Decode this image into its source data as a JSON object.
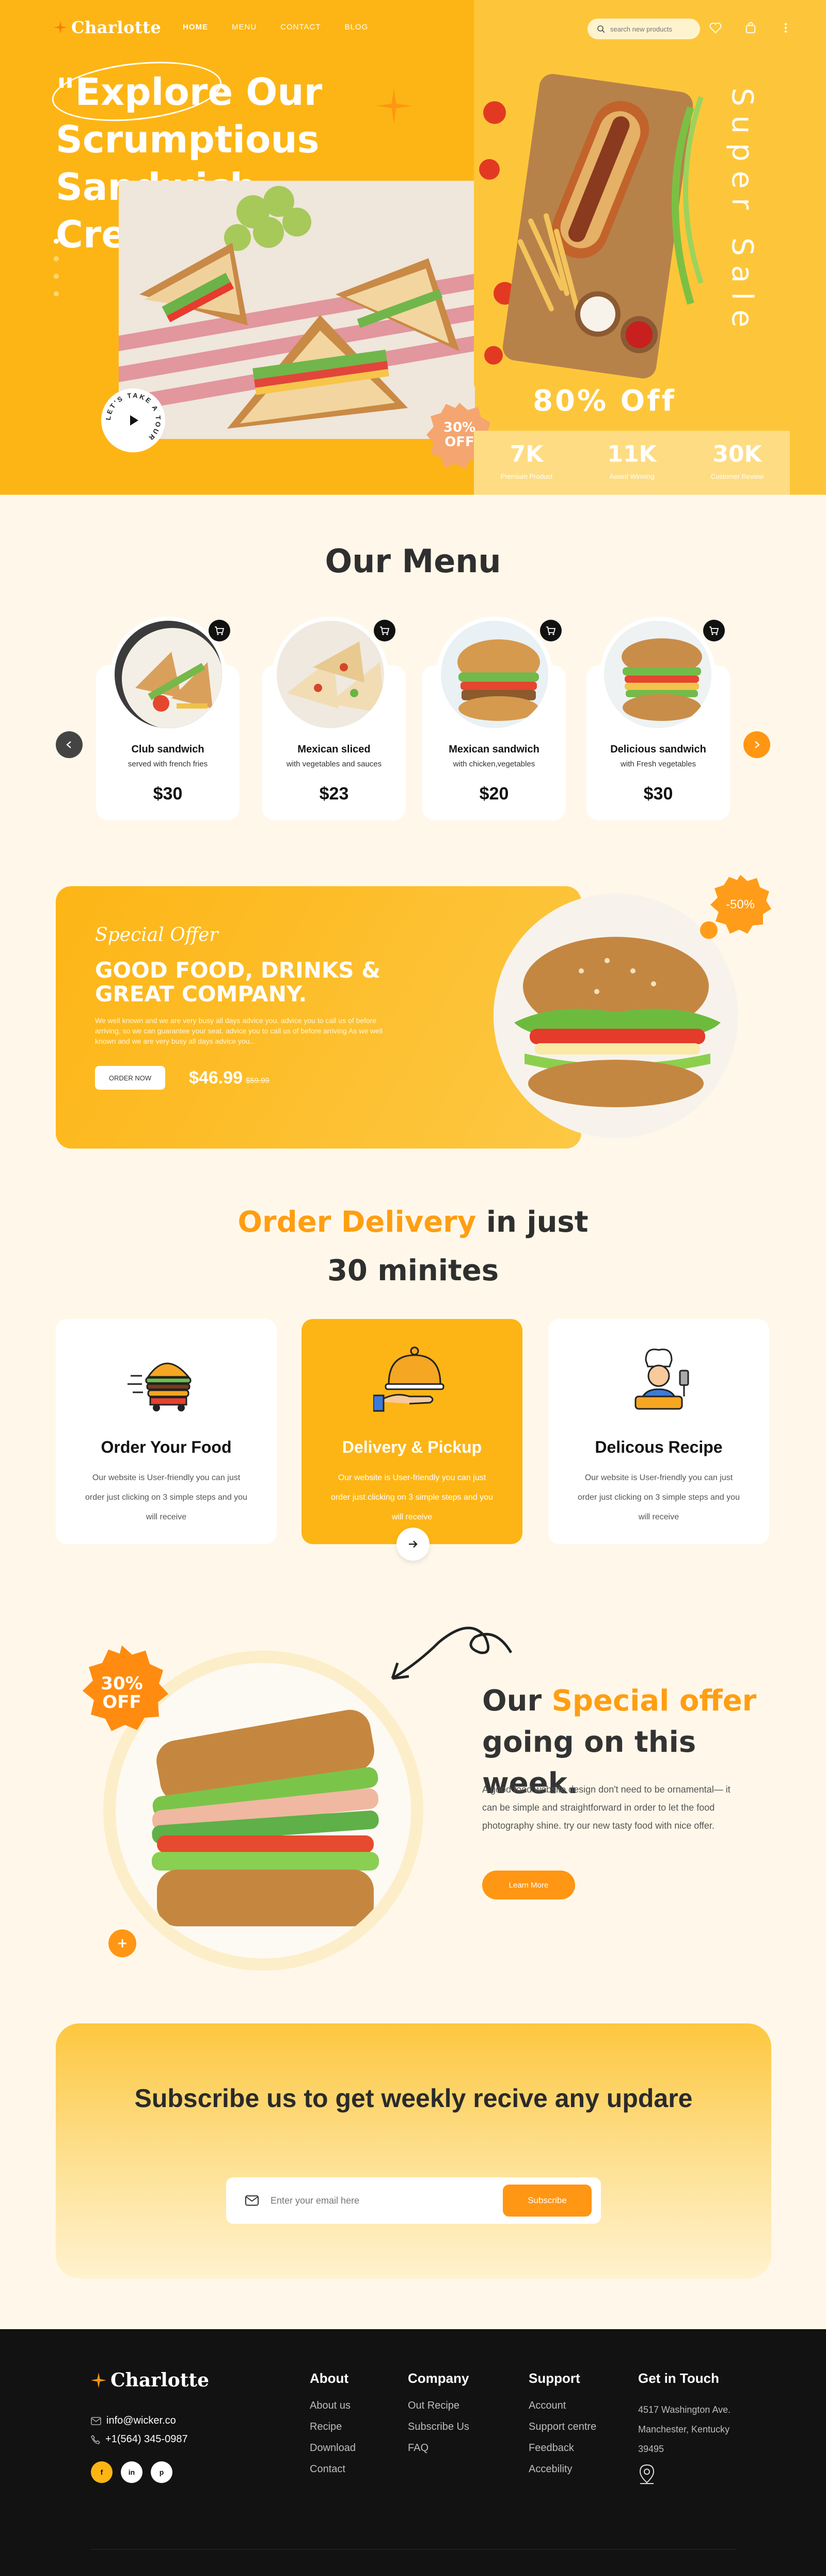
{
  "brand": {
    "name": "Charlotte",
    "accent": "#fdb515",
    "orange": "#ff9614"
  },
  "nav": {
    "items": [
      {
        "label": "HOME",
        "active": true
      },
      {
        "label": "MENU",
        "active": false
      },
      {
        "label": "CONTACT",
        "active": false
      },
      {
        "label": "BLOG",
        "active": false
      }
    ]
  },
  "search": {
    "placeholder": "search new products"
  },
  "icons": [
    "search-icon",
    "heart-icon",
    "bag-icon",
    "menu-dots-icon"
  ],
  "hero": {
    "title": "\"Explore Our Scrumptious Sandwich Creations\"",
    "tour": "LET'S TAKE A TOUR",
    "badge": "30% OFF",
    "super_sale": "Super Sale",
    "promo": "80% Off",
    "stats": [
      {
        "num": "7K",
        "label": "Premium Product"
      },
      {
        "num": "11K",
        "label": "Award Winning"
      },
      {
        "num": "30K",
        "label": "Customer Review"
      }
    ]
  },
  "menu": {
    "title": "Our Menu",
    "items": [
      {
        "name": "Club sandwich",
        "desc": "served with french fries",
        "price": "$30"
      },
      {
        "name": "Mexican sliced",
        "desc": "with vegetables and sauces",
        "price": "$23"
      },
      {
        "name": "Mexican sandwich",
        "desc": "with chicken,vegetables",
        "price": "$20"
      },
      {
        "name": "Delicious sandwich",
        "desc": "with Fresh vegetables",
        "price": "$30"
      }
    ]
  },
  "special": {
    "script": "Special Offer",
    "headline": "GOOD FOOD, DRINKS & GREAT COMPANY.",
    "text": "We well known and we are very busy all days advice you. advice you to call us of before arriving, so we can guarantee your seat. advice you to call us of before arriving As we well known and we are very busy all days advice you...",
    "button": "ORDER NOW",
    "price": "$46.99",
    "old_price": "$59.99",
    "badge": "-50%"
  },
  "delivery": {
    "title_orange": "Order Delivery",
    "title_rest": "in just",
    "title_line2": "30 minites",
    "cards": [
      {
        "title": "Order Your Food",
        "text": "Our website is User-friendly you can just order just clicking on 3 simple steps and you will receive"
      },
      {
        "title": "Delivery & Pickup",
        "text": "Our website is User-friendly you can just order just clicking on 3 simple steps and you will receive"
      },
      {
        "title": "Delicous Recipe",
        "text": "Our website is User-friendly you can just order just clicking on 3 simple steps and you will receive"
      }
    ]
  },
  "weekly": {
    "badge": "30% OFF",
    "head_our": "Our",
    "head_orange": "Special offer",
    "head_rest": "going on this week.",
    "text": "A good food website design don't need to be ornamental— it can be simple and straightforward in order to let the food photography shine. try our new tasty food with nice offer.",
    "button": "Learn More"
  },
  "subscribe": {
    "title": "Subscribe us to get weekly recive any updare",
    "placeholder": "Enter your email here",
    "button": "Subscribe"
  },
  "footer": {
    "email": "info@wicker.co",
    "phone": "+1(564) 345-0987",
    "social": [
      "f",
      "in",
      "p"
    ],
    "about": {
      "title": "About",
      "links": [
        "About us",
        "Recipe",
        "Download",
        "Contact"
      ]
    },
    "company": {
      "title": "Company",
      "links": [
        "Out Recipe",
        "Subscribe Us",
        "FAQ"
      ]
    },
    "support": {
      "title": "Support",
      "links": [
        "Account",
        "Support centre",
        "Feedback",
        "Accebility"
      ]
    },
    "touch": {
      "title": "Get in Touch",
      "address": "4517 Washington Ave. Manchester, Kentucky 39495"
    }
  }
}
